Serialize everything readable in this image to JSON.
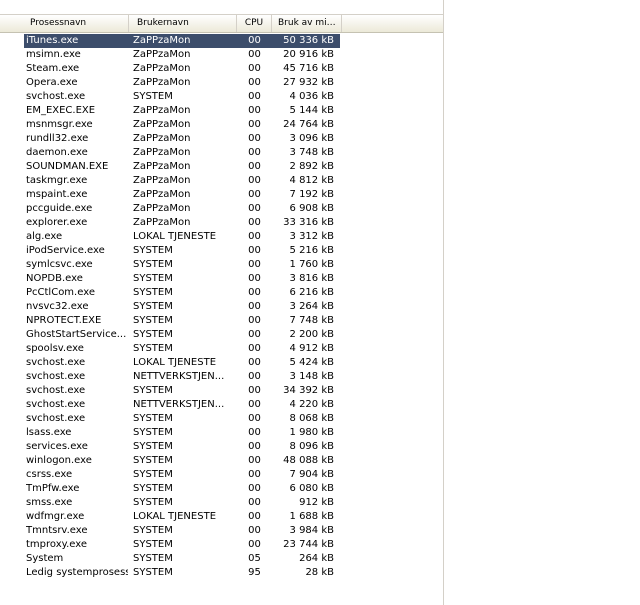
{
  "columns": [
    "Prosessnavn",
    "Brukernavn",
    "CPU",
    "Bruk av mi…"
  ],
  "rows": [
    [
      "iTunes.exe",
      "ZaPPzaMon",
      "00",
      "50 336 kB"
    ],
    [
      "msimn.exe",
      "ZaPPzaMon",
      "00",
      "20 916 kB"
    ],
    [
      "Steam.exe",
      "ZaPPzaMon",
      "00",
      "45 716 kB"
    ],
    [
      "Opera.exe",
      "ZaPPzaMon",
      "00",
      "27 932 kB"
    ],
    [
      "svchost.exe",
      "SYSTEM",
      "00",
      "4 036 kB"
    ],
    [
      "EM_EXEC.EXE",
      "ZaPPzaMon",
      "00",
      "5 144 kB"
    ],
    [
      "msnmsgr.exe",
      "ZaPPzaMon",
      "00",
      "24 764 kB"
    ],
    [
      "rundll32.exe",
      "ZaPPzaMon",
      "00",
      "3 096 kB"
    ],
    [
      "daemon.exe",
      "ZaPPzaMon",
      "00",
      "3 748 kB"
    ],
    [
      "SOUNDMAN.EXE",
      "ZaPPzaMon",
      "00",
      "2 892 kB"
    ],
    [
      "taskmgr.exe",
      "ZaPPzaMon",
      "00",
      "4 812 kB"
    ],
    [
      "mspaint.exe",
      "ZaPPzaMon",
      "00",
      "7 192 kB"
    ],
    [
      "pccguide.exe",
      "ZaPPzaMon",
      "00",
      "6 908 kB"
    ],
    [
      "explorer.exe",
      "ZaPPzaMon",
      "00",
      "33 316 kB"
    ],
    [
      "alg.exe",
      "LOKAL TJENESTE",
      "00",
      "3 312 kB"
    ],
    [
      "iPodService.exe",
      "SYSTEM",
      "00",
      "5 216 kB"
    ],
    [
      "symlcsvc.exe",
      "SYSTEM",
      "00",
      "1 760 kB"
    ],
    [
      "NOPDB.exe",
      "SYSTEM",
      "00",
      "3 816 kB"
    ],
    [
      "PcCtlCom.exe",
      "SYSTEM",
      "00",
      "6 216 kB"
    ],
    [
      "nvsvc32.exe",
      "SYSTEM",
      "00",
      "3 264 kB"
    ],
    [
      "NPROTECT.EXE",
      "SYSTEM",
      "00",
      "7 748 kB"
    ],
    [
      "GhostStartService...",
      "SYSTEM",
      "00",
      "2 200 kB"
    ],
    [
      "spoolsv.exe",
      "SYSTEM",
      "00",
      "4 912 kB"
    ],
    [
      "svchost.exe",
      "LOKAL TJENESTE",
      "00",
      "5 424 kB"
    ],
    [
      "svchost.exe",
      "NETTVERKSTJEN...",
      "00",
      "3 148 kB"
    ],
    [
      "svchost.exe",
      "SYSTEM",
      "00",
      "34 392 kB"
    ],
    [
      "svchost.exe",
      "NETTVERKSTJEN...",
      "00",
      "4 220 kB"
    ],
    [
      "svchost.exe",
      "SYSTEM",
      "00",
      "8 068 kB"
    ],
    [
      "lsass.exe",
      "SYSTEM",
      "00",
      "1 980 kB"
    ],
    [
      "services.exe",
      "SYSTEM",
      "00",
      "8 096 kB"
    ],
    [
      "winlogon.exe",
      "SYSTEM",
      "00",
      "48 088 kB"
    ],
    [
      "csrss.exe",
      "SYSTEM",
      "00",
      "7 904 kB"
    ],
    [
      "TmPfw.exe",
      "SYSTEM",
      "00",
      "6 080 kB"
    ],
    [
      "smss.exe",
      "SYSTEM",
      "00",
      "912 kB"
    ],
    [
      "wdfmgr.exe",
      "LOKAL TJENESTE",
      "00",
      "1 688 kB"
    ],
    [
      "Tmntsrv.exe",
      "SYSTEM",
      "00",
      "3 984 kB"
    ],
    [
      "tmproxy.exe",
      "SYSTEM",
      "00",
      "23 744 kB"
    ],
    [
      "System",
      "SYSTEM",
      "05",
      "264 kB"
    ],
    [
      "Ledig systemprosess",
      "SYSTEM",
      "95",
      "28 kB"
    ]
  ],
  "selected_row": 0,
  "colors": {
    "selection": "#3c4d6b",
    "header_border": "#d4d0c8"
  }
}
